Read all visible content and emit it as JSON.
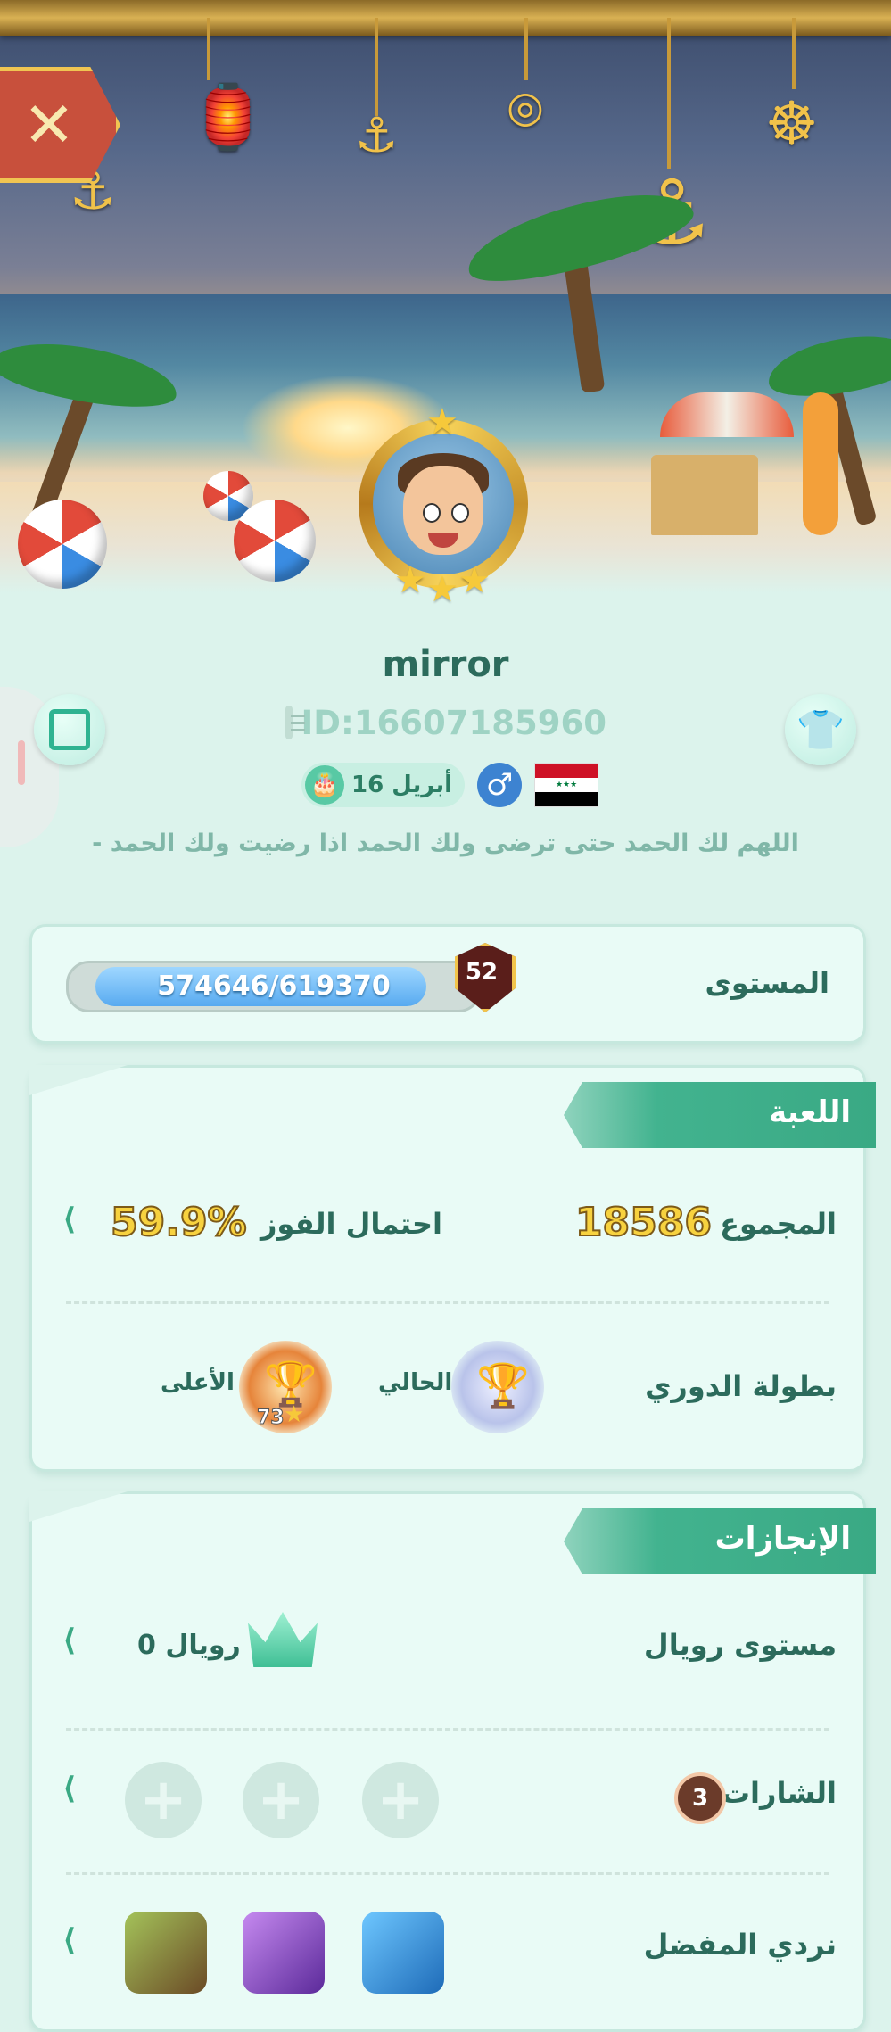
{
  "header": {
    "close_label": "✕"
  },
  "profile": {
    "username": "mirror",
    "id_text": "ID:16607185960",
    "birthday": "16 أبريل",
    "gender_symbol": "♂",
    "country": "Iraq",
    "bio": "- اللهم لك الحمد حتى ترضى ولك الحمد اذا رضيت ولك الحمد"
  },
  "level_card": {
    "label": "المستوى",
    "progress_text": "574646/619370",
    "progress_fraction": 0.928,
    "level": "52"
  },
  "game_card": {
    "ribbon": "اللعبة",
    "total_label": "المجموع",
    "total_value": "18586",
    "winrate_label": "احتمال الفوز",
    "winrate_value": "59.9%",
    "league_label": "بطولة الدوري",
    "current_label": "الحالي",
    "highest_label": "الأعلى",
    "highest_stars": "73"
  },
  "achievements_card": {
    "ribbon": "الإنجازات",
    "royal_label": "مستوى رويال",
    "royal_value": "رويال 0",
    "badges_label": "الشارات",
    "badges_count": "3",
    "dice_label": "نردي المفضل"
  },
  "colors": {
    "accent": "#3aa984",
    "text": "#2c6b5c",
    "gold": "#f7d23f"
  }
}
